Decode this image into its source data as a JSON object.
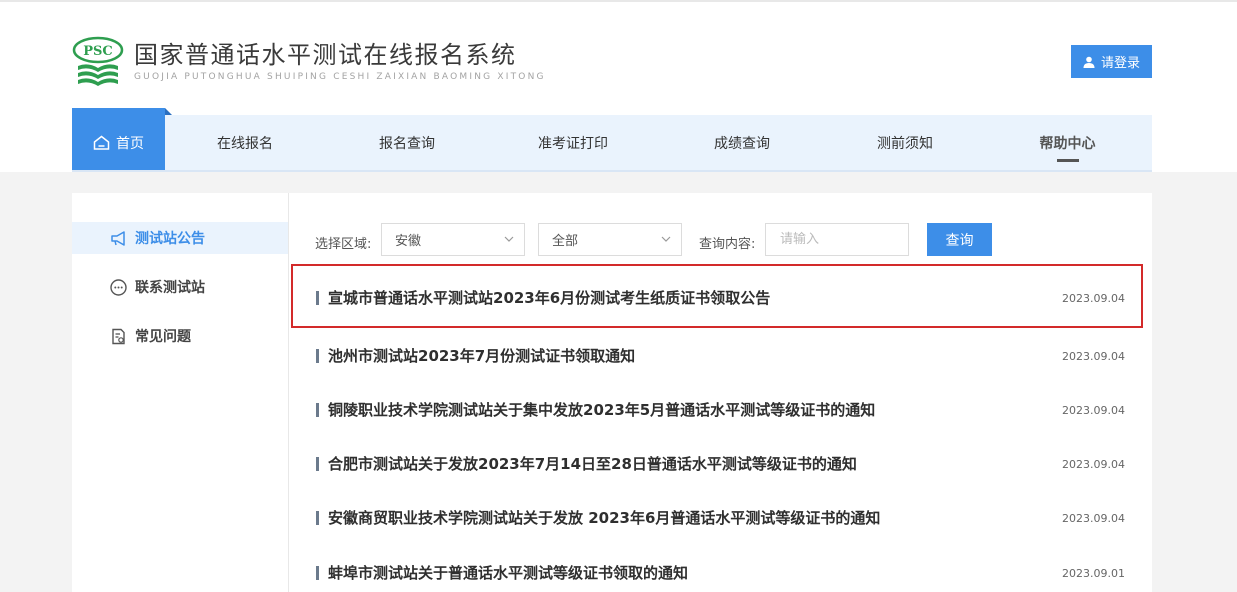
{
  "header": {
    "title": "国家普通话水平测试在线报名系统",
    "subtitle": "GUOJIA PUTONGHUA SHUIPING CESHI ZAIXIAN BAOMING XITONG",
    "logo_text": "PSC",
    "login_label": "请登录"
  },
  "nav": {
    "items": [
      {
        "label": "首页"
      },
      {
        "label": "在线报名"
      },
      {
        "label": "报名查询"
      },
      {
        "label": "准考证打印"
      },
      {
        "label": "成绩查询"
      },
      {
        "label": "测前须知"
      },
      {
        "label": "帮助中心"
      }
    ]
  },
  "sidebar": {
    "items": [
      {
        "label": "测试站公告"
      },
      {
        "label": "联系测试站"
      },
      {
        "label": "常见问题"
      }
    ]
  },
  "filter": {
    "region_label": "选择区域:",
    "region_value": "安徽",
    "category_value": "全部",
    "query_label": "查询内容:",
    "query_placeholder": "请输入",
    "query_button": "查询"
  },
  "news": [
    {
      "title": "宣城市普通话水平测试站2023年6月份测试考生纸质证书领取公告",
      "date": "2023.09.04"
    },
    {
      "title": "池州市测试站2023年7月份测试证书领取通知",
      "date": "2023.09.04"
    },
    {
      "title": "铜陵职业技术学院测试站关于集中发放2023年5月普通话水平测试等级证书的通知",
      "date": "2023.09.04"
    },
    {
      "title": "合肥市测试站关于发放2023年7月14日至28日普通话水平测试等级证书的通知",
      "date": "2023.09.04"
    },
    {
      "title": "安徽商贸职业技术学院测试站关于发放 2023年6月普通话水平测试等级证书的通知",
      "date": "2023.09.04"
    },
    {
      "title": "蚌埠市测试站关于普通话水平测试等级证书领取的通知",
      "date": "2023.09.01"
    }
  ],
  "colors": {
    "accent": "#3d8ee8",
    "highlight_border": "#d32a2a",
    "logo_green": "#2e9e4f"
  }
}
